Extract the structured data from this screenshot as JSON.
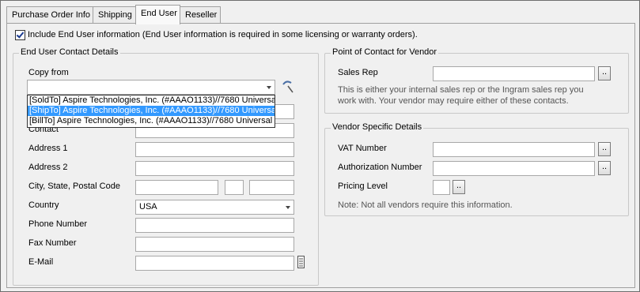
{
  "tabs": [
    "Purchase Order Info",
    "Shipping",
    "End User",
    "Reseller"
  ],
  "include_checkbox": {
    "checked": true,
    "label": "Include End User information (End User information is required in some licensing or warranty orders)."
  },
  "contact_group": {
    "title": "End User Contact Details",
    "copy_from_label": "Copy from",
    "copy_from_value": "",
    "dropdown_options": [
      "[SoldTo] Aspire Technologies, Inc. (#AAAO1133)//7680 Universa",
      "[ShipTo] Aspire Technologies, Inc. (#AAAO1133)//7680 Universa",
      "[BillTo] Aspire Technologies, Inc. (#AAAO1133)//7680 Universal"
    ],
    "dropdown_selected_index": 1,
    "fields": {
      "contact": "Contact",
      "address1": "Address 1",
      "address2": "Address 2",
      "city_state_postal": "City, State, Postal Code",
      "country": "Country",
      "phone": "Phone Number",
      "fax": "Fax Number",
      "email": "E-Mail"
    },
    "country_value": "USA"
  },
  "vendor_contact_group": {
    "title": "Point of Contact for Vendor",
    "sales_rep_label": "Sales Rep",
    "note": "This is either your internal sales rep or the Ingram sales rep you work with. Your vendor may require either of these contacts."
  },
  "vendor_details_group": {
    "title": "Vendor Specific Details",
    "vat_label": "VAT Number",
    "auth_label": "Authorization Number",
    "pricing_label": "Pricing Level",
    "note": "Note: Not all vendors require this information."
  },
  "browse_label": "..",
  "icons": [
    "checkbox-checked-icon",
    "combo-arrow-icon",
    "wand-icon",
    "address-book-icon"
  ]
}
